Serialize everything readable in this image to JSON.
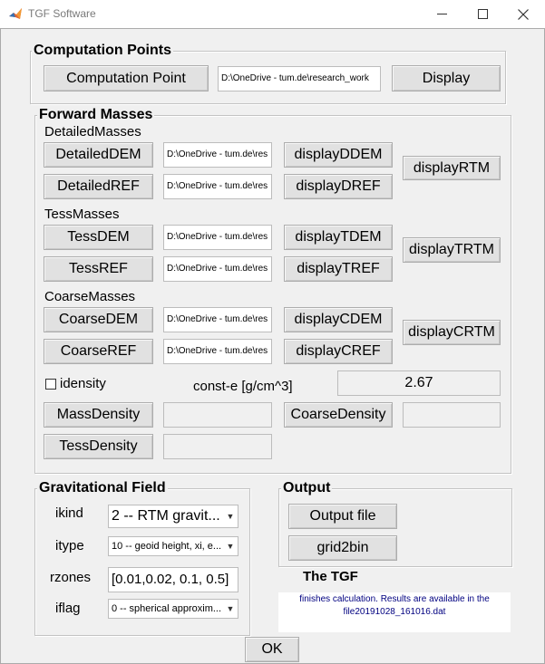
{
  "window": {
    "title": "TGF Software"
  },
  "computation_points": {
    "title": "Computation Points",
    "computation_point_button": "Computation Point",
    "path_field": "D:\\OneDrive - tum.de\\research_work",
    "display_button": "Display"
  },
  "forward_masses": {
    "title": "Forward Masses",
    "detailed": {
      "heading": "DetailedMasses",
      "dem_button": "DetailedDEM",
      "dem_path": "D:\\OneDrive - tum.de\\res",
      "display_dem_button": "displayDDEM",
      "ref_button": "DetailedREF",
      "ref_path": "D:\\OneDrive - tum.de\\res",
      "display_ref_button": "displayDREF",
      "rtm_button": "displayRTM"
    },
    "tess": {
      "heading": "TessMasses",
      "dem_button": "TessDEM",
      "dem_path": "D:\\OneDrive - tum.de\\res",
      "display_dem_button": "displayTDEM",
      "ref_button": "TessREF",
      "ref_path": "D:\\OneDrive - tum.de\\res",
      "display_ref_button": "displayTREF",
      "rtm_button": "displayTRTM"
    },
    "coarse": {
      "heading": "CoarseMasses",
      "dem_button": "CoarseDEM",
      "dem_path": "D:\\OneDrive - tum.de\\res",
      "display_dem_button": "displayCDEM",
      "ref_button": "CoarseREF",
      "ref_path": "D:\\OneDrive - tum.de\\res",
      "display_ref_button": "displayCREF",
      "rtm_button": "displayCRTM"
    },
    "idensity_label": "idensity",
    "idensity_checked": false,
    "const_label": "const-e [g/cm^3]",
    "const_value": "2.67",
    "mass_density_button": "MassDensity",
    "mass_density_value": "",
    "coarse_density_button": "CoarseDensity",
    "coarse_density_value": "",
    "tess_density_button": "TessDensity",
    "tess_density_value": ""
  },
  "gravitational_field": {
    "title": "Gravitational Field",
    "ikind_label": "ikind",
    "ikind_value": "2 -- RTM gravit...",
    "itype_label": "itype",
    "itype_value": "10 -- geoid height, xi, e...",
    "rzones_label": "rzones",
    "rzones_value": "[0.01,0.02, 0.1, 0.5]",
    "iflag_label": "iflag",
    "iflag_value": "0 -- spherical approxim..."
  },
  "output": {
    "title": "Output",
    "output_file_button": "Output file",
    "grid2bin_button": "grid2bin",
    "tgf_label": "The TGF",
    "status_line1": "finishes calculation. Results are available in the",
    "status_line2": "file20191028_161016.dat"
  },
  "ok_button": "OK",
  "colors": {
    "window_bg": "#f0f0f0",
    "button_bg": "#e1e1e1",
    "status_text": "#000080"
  },
  "icons": [
    "matlab-logo-icon",
    "minimize-icon",
    "maximize-icon",
    "close-icon",
    "chevron-down-icon"
  ]
}
